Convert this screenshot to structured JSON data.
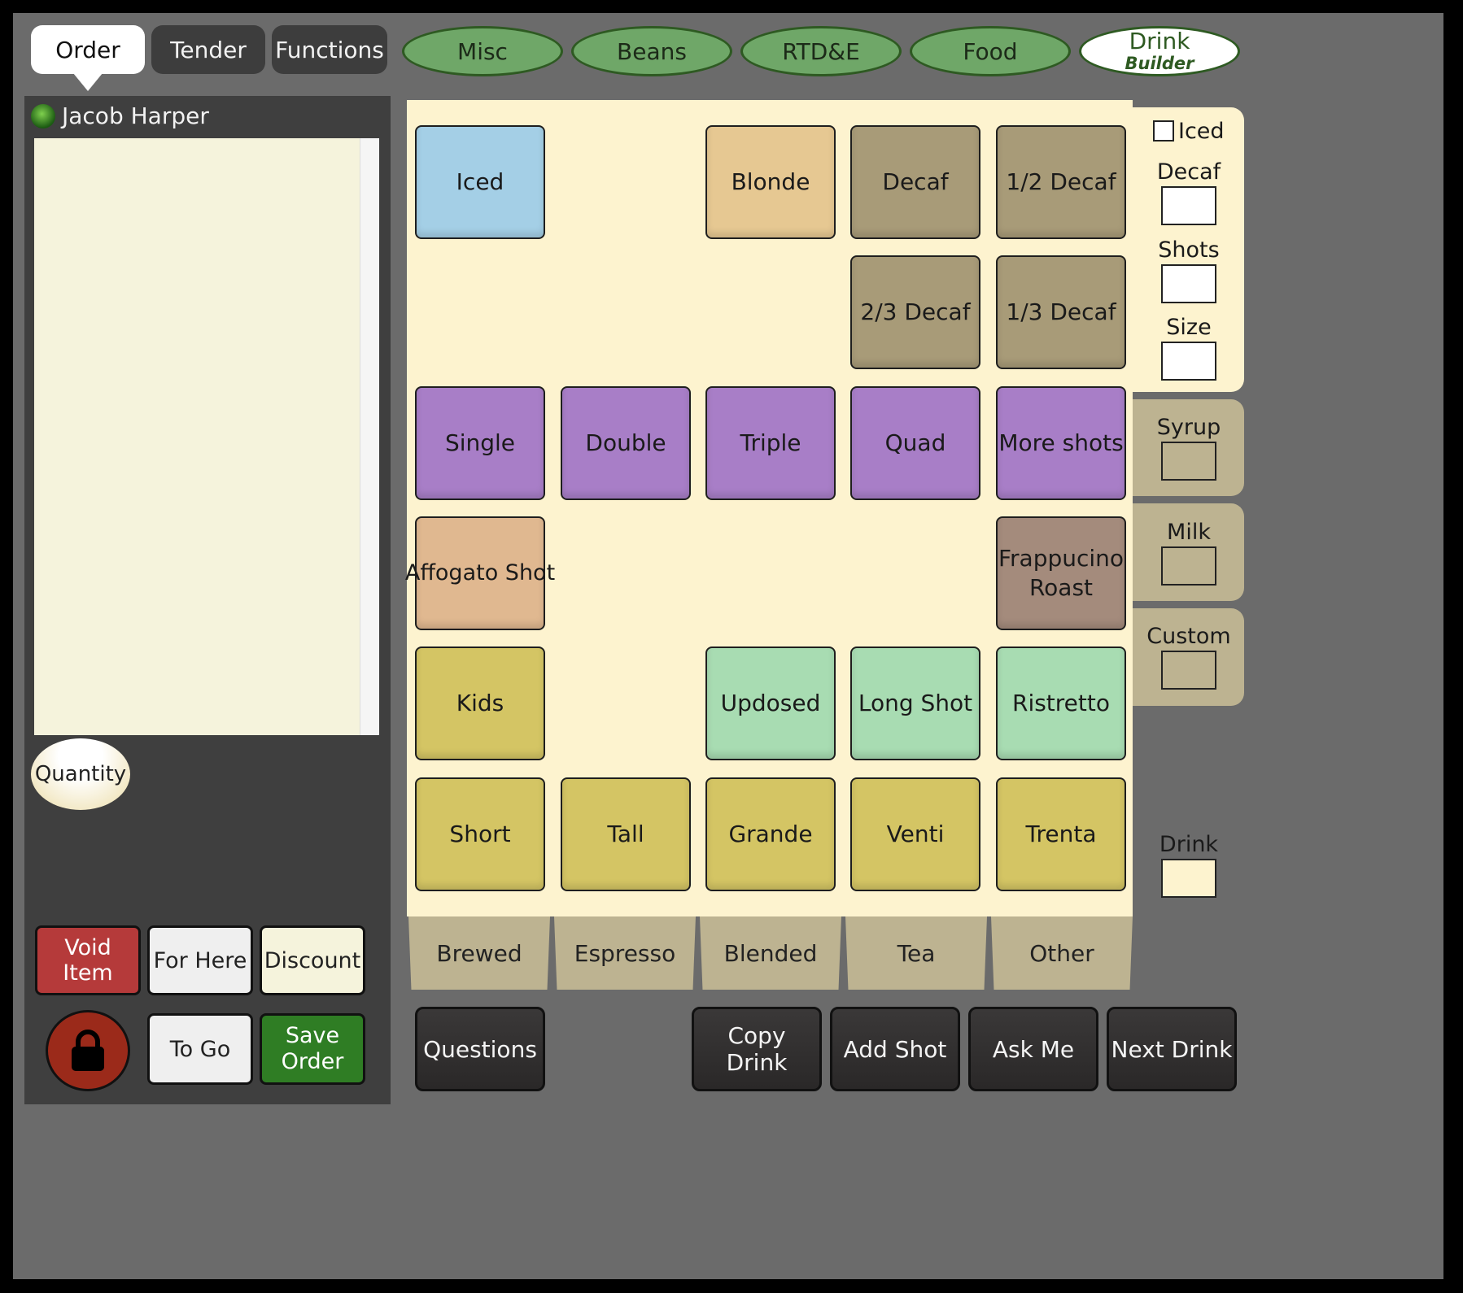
{
  "top_tabs": [
    {
      "label": "Order",
      "active": true
    },
    {
      "label": "Tender",
      "active": false
    },
    {
      "label": "Functions",
      "active": false
    }
  ],
  "category_ovals": [
    "Misc",
    "Beans",
    "RTD&E",
    "Food"
  ],
  "drink_builder": {
    "line1": "Drink",
    "line2": "Builder"
  },
  "customer": {
    "name": "Jacob Harper",
    "status_color": "#4caf2a"
  },
  "quantity_label": "Quantity",
  "left_buttons": {
    "void_item": "Void Item",
    "for_here": "For Here",
    "discount": "Discount",
    "to_go": "To Go",
    "save_order_line1": "Save",
    "save_order_line2": "Order"
  },
  "grid": {
    "iced": "Iced",
    "blonde": "Blonde",
    "decaf": "Decaf",
    "half_decaf": "1/2 Decaf",
    "two_thirds_decaf": "2/3 Decaf",
    "one_third_decaf": "1/3 Decaf",
    "single": "Single",
    "double": "Double",
    "triple": "Triple",
    "quad": "Quad",
    "more_shots": "More shots",
    "affogato": "Affogato Shot",
    "frap_roast_line1": "Frappucino",
    "frap_roast_line2": "Roast",
    "kids": "Kids",
    "updosed": "Updosed",
    "long_shot": "Long Shot",
    "ristretto": "Ristretto",
    "short": "Short",
    "tall": "Tall",
    "grande": "Grande",
    "venti": "Venti",
    "trenta": "Trenta"
  },
  "category_tabs": [
    "Brewed",
    "Espresso",
    "Blended",
    "Tea",
    "Other"
  ],
  "side_panel": {
    "iced_label": "Iced",
    "iced_checked": false,
    "decaf": "Decaf",
    "shots": "Shots",
    "size": "Size",
    "syrup": "Syrup",
    "milk": "Milk",
    "custom": "Custom",
    "drink": "Drink"
  },
  "action_buttons": {
    "questions": "Questions",
    "copy_drink": "Copy Drink",
    "add_shot": "Add Shot",
    "ask_me": "Ask Me",
    "next_drink": "Next Drink"
  },
  "colors": {
    "accent_green": "#6fa768",
    "void_red": "#b53a3a",
    "save_green": "#2f7d24",
    "grid_background": "#fdf3cf"
  }
}
